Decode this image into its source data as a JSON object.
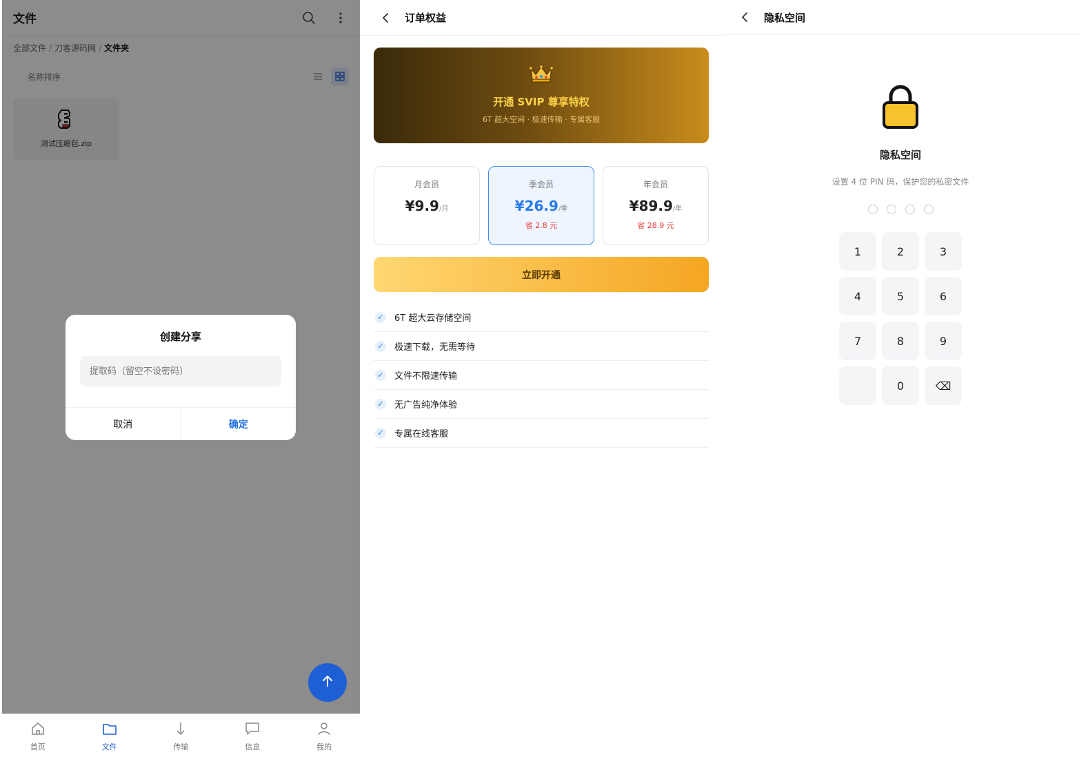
{
  "files": {
    "title": "文件",
    "breadcrumb": [
      "全部文件",
      "刀客源码网",
      "文件夹"
    ],
    "sort_label": "名称排序",
    "file": {
      "name": "测试压缩包.zip"
    },
    "dialog": {
      "title": "创建分享",
      "placeholder": "提取码（留空不设密码）",
      "cancel": "取消",
      "confirm": "确定"
    },
    "tabs": [
      {
        "label": "首页",
        "icon": "home-icon"
      },
      {
        "label": "文件",
        "icon": "folder-icon",
        "active": true
      },
      {
        "label": "传输",
        "icon": "download-icon"
      },
      {
        "label": "信息",
        "icon": "message-icon"
      },
      {
        "label": "我的",
        "icon": "user-icon"
      }
    ]
  },
  "order": {
    "title": "订单权益",
    "banner": {
      "title": "开通 SVIP 尊享特权",
      "subtitle": "6T 超大空间 · 极速传输 · 专属客服"
    },
    "plans": [
      {
        "name": "月会员",
        "price": "¥9.9",
        "unit": "/月",
        "save": ""
      },
      {
        "name": "季会员",
        "price": "¥26.9",
        "unit": "/季",
        "save": "省 2.8 元",
        "selected": true
      },
      {
        "name": "年会员",
        "price": "¥89.9",
        "unit": "/年",
        "save": "省 28.9 元"
      }
    ],
    "button": "立即开通",
    "benefits": [
      "6T 超大云存储空间",
      "极速下载，无需等待",
      "文件不限速传输",
      "无广告纯净体验",
      "专属在线客服"
    ],
    "accent": "#2a7ae8"
  },
  "private": {
    "title": "隐私空间",
    "heading": "隐私空间",
    "subtitle": "设置 4 位 PIN 码，保护您的私密文件",
    "keys": [
      "1",
      "2",
      "3",
      "4",
      "5",
      "6",
      "7",
      "8",
      "9",
      "",
      "0",
      "⌫"
    ]
  }
}
